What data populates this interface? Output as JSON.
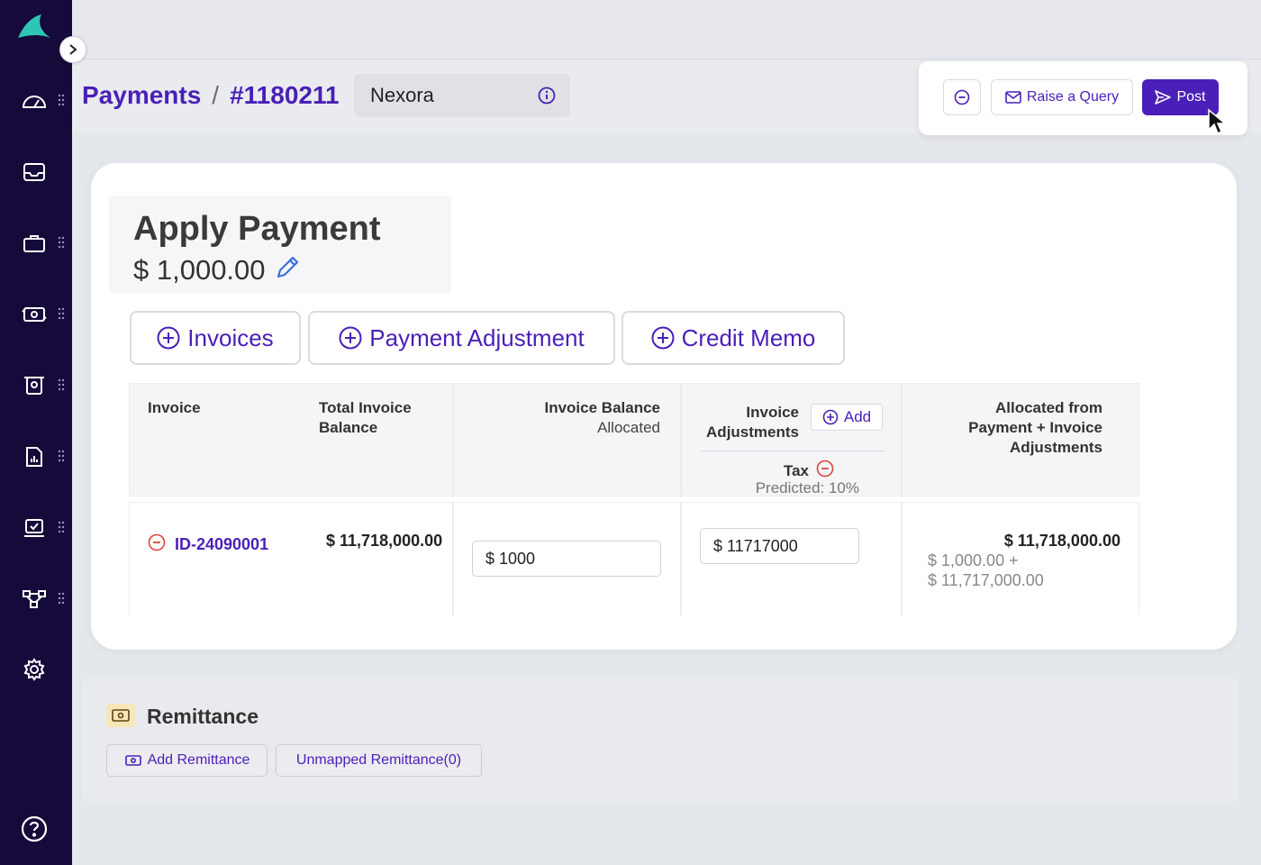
{
  "breadcrumb": {
    "section": "Payments",
    "separator": "/",
    "payment_id": "#1180211"
  },
  "customer": {
    "name": "Nexora"
  },
  "actions": {
    "raise_query": "Raise a Query",
    "post": "Post"
  },
  "apply": {
    "title": "Apply Payment",
    "amount": "$ 1,000.00"
  },
  "tabs": [
    {
      "label": "Invoices"
    },
    {
      "label": "Payment Adjustment"
    },
    {
      "label": "Credit Memo"
    }
  ],
  "table": {
    "headers": {
      "invoice": "Invoice",
      "total_line1": "Total Invoice",
      "total_line2": "Balance",
      "balance_line1": "Invoice Balance",
      "balance_line2": "Allocated",
      "adj_line1": "Invoice",
      "adj_line2": "Adjustments",
      "add_label": "Add",
      "tax_label": "Tax",
      "tax_predicted": "Predicted: 10%",
      "alloc_line1": "Allocated from",
      "alloc_line2": "Payment + Invoice",
      "alloc_line3": "Adjustments"
    },
    "rows": [
      {
        "invoice_id": "ID-24090001",
        "total_balance": "$ 11,718,000.00",
        "balance_allocated": "$ 1000",
        "tax_value": "$ 11717000",
        "allocated_total": "$ 11,718,000.00",
        "allocated_payment": "$ 1,000.00 +",
        "allocated_adjustment": "$ 11,717,000.00"
      }
    ]
  },
  "remittance": {
    "title": "Remittance",
    "add_label": "Add Remittance",
    "unmapped_label": "Unmapped Remittance(0)"
  },
  "colors": {
    "brand": "#4a1fb8",
    "sidebar": "#150a3a",
    "logo": "#2ec4b6",
    "danger": "#d9463b"
  }
}
